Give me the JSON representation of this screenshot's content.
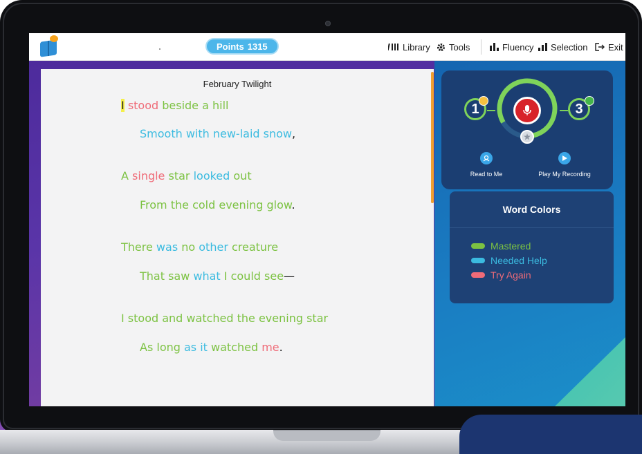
{
  "header": {
    "points_label": "Points",
    "points_value": "1315",
    "nav": [
      {
        "label": "Library",
        "icon": "library-icon"
      },
      {
        "label": "Tools",
        "icon": "gear-icon"
      },
      {
        "label": "Fluency",
        "icon": "bar-chart-icon"
      },
      {
        "label": "Selection",
        "icon": "bar-chart-icon"
      },
      {
        "label": "Exit",
        "icon": "exit-icon"
      }
    ]
  },
  "poem": {
    "title": "February Twilight",
    "lines": [
      [
        {
          "t": "I",
          "c": "hl"
        },
        {
          "t": " ",
          "c": "k"
        },
        {
          "t": "stood",
          "c": "r"
        },
        {
          "t": " beside a hill",
          "c": "g"
        }
      ],
      [
        {
          "t": "Smooth with new-laid ",
          "c": "b"
        },
        {
          "t": "snow",
          "c": "b"
        },
        {
          "t": ",",
          "c": "k"
        }
      ],
      [
        {
          "t": "A ",
          "c": "g"
        },
        {
          "t": "single",
          "c": "r"
        },
        {
          "t": " star ",
          "c": "g"
        },
        {
          "t": "looked",
          "c": "b"
        },
        {
          "t": " out",
          "c": "g"
        }
      ],
      [
        {
          "t": "From the cold evening glow",
          "c": "g"
        },
        {
          "t": ".",
          "c": "k"
        }
      ],
      [
        {
          "t": "There ",
          "c": "g"
        },
        {
          "t": "was",
          "c": "b"
        },
        {
          "t": " no ",
          "c": "g"
        },
        {
          "t": "other",
          "c": "b"
        },
        {
          "t": " creature",
          "c": "g"
        }
      ],
      [
        {
          "t": "That saw ",
          "c": "g"
        },
        {
          "t": "what",
          "c": "b"
        },
        {
          "t": " I could see",
          "c": "g"
        },
        {
          "t": "—",
          "c": "k"
        }
      ],
      [
        {
          "t": "I stood and watched the evening star",
          "c": "g"
        }
      ],
      [
        {
          "t": "As long ",
          "c": "g"
        },
        {
          "t": "as it",
          "c": "b"
        },
        {
          "t": " watched ",
          "c": "g"
        },
        {
          "t": "me",
          "c": "r"
        },
        {
          "t": ".",
          "c": "k"
        }
      ]
    ]
  },
  "recorder": {
    "left_count": "1",
    "right_count": "3",
    "read_to_me_label": "Read to Me",
    "play_recording_label": "Play My Recording"
  },
  "word_colors": {
    "title": "Word Colors",
    "items": [
      {
        "label": "Mastered",
        "color": "#7cc242"
      },
      {
        "label": "Needed Help",
        "color": "#3bbbe0"
      },
      {
        "label": "Try Again",
        "color": "#ef6b78"
      }
    ]
  },
  "colors": {
    "mastered": "#7cc242",
    "needed_help": "#3bbbe0",
    "try_again": "#ef6b78",
    "highlight": "#f4ef4a",
    "points_pill": "#4cb6ea",
    "mic": "#d8232a"
  }
}
